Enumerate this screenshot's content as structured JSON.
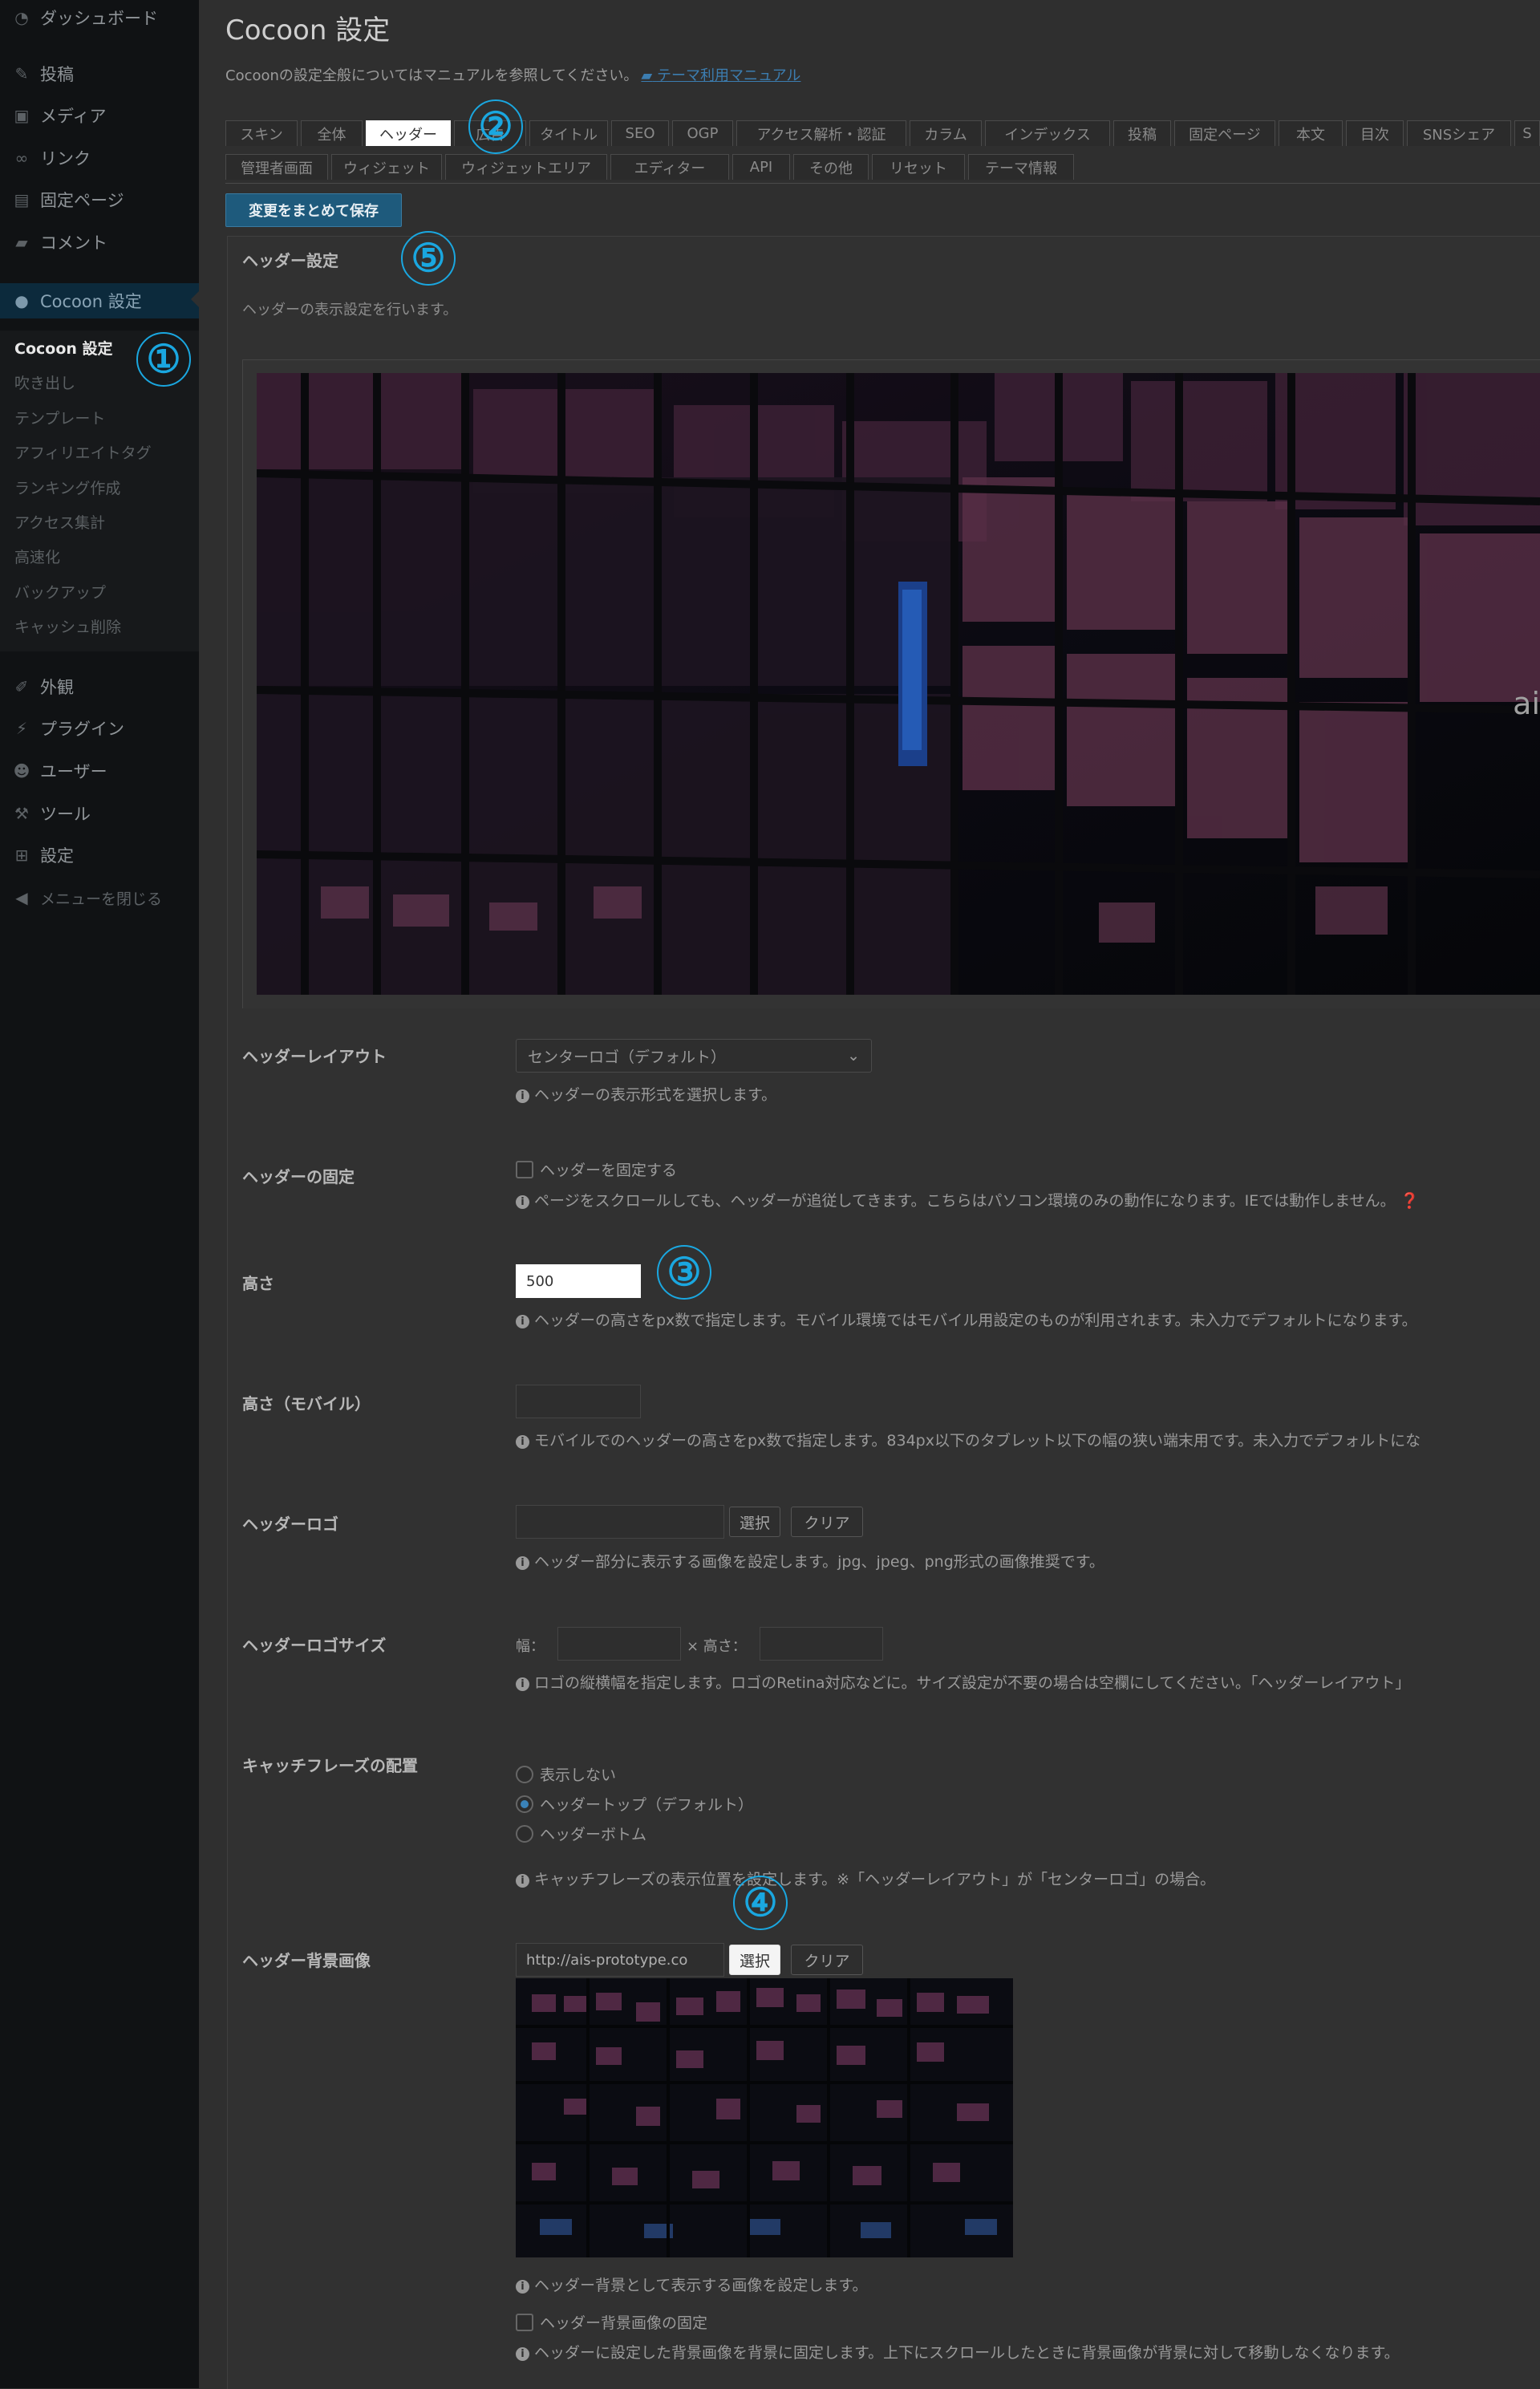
{
  "sidebar": {
    "menu": [
      {
        "label": "ダッシュボード",
        "icon": "dashboard-icon"
      },
      {
        "label": "投稿",
        "icon": "pin-icon"
      },
      {
        "label": "メディア",
        "icon": "media-icon"
      },
      {
        "label": "リンク",
        "icon": "link-icon"
      },
      {
        "label": "固定ページ",
        "icon": "page-icon"
      },
      {
        "label": "コメント",
        "icon": "comment-icon"
      },
      {
        "label": "Cocoon 設定",
        "icon": "cocoon-icon"
      }
    ],
    "submenu": [
      "Cocoon 設定",
      "吹き出し",
      "テンプレート",
      "アフィリエイトタグ",
      "ランキング作成",
      "アクセス集計",
      "高速化",
      "バックアップ",
      "キャッシュ削除"
    ],
    "menu2": [
      {
        "label": "外観",
        "icon": "brush-icon"
      },
      {
        "label": "プラグイン",
        "icon": "plugin-icon"
      },
      {
        "label": "ユーザー",
        "icon": "user-icon"
      },
      {
        "label": "ツール",
        "icon": "wrench-icon"
      },
      {
        "label": "設定",
        "icon": "settings-icon"
      },
      {
        "label": "メニューを閉じる",
        "icon": "collapse-icon"
      }
    ]
  },
  "page": {
    "title": "Cocoon 設定",
    "intro": "Cocoonの設定全般についてはマニュアルを参照してください。",
    "manual_link": "テーマ利用マニュアル"
  },
  "tabs_row1": [
    "スキン",
    "全体",
    "ヘッダー",
    "広告",
    "タイトル",
    "SEO",
    "OGP",
    "アクセス解析・認証",
    "カラム",
    "インデックス",
    "投稿",
    "固定ページ",
    "本文",
    "目次",
    "SNSシェア",
    "S"
  ],
  "tabs_row2": [
    "管理者画面",
    "ウィジェット",
    "ウィジェットエリア",
    "エディター",
    "API",
    "その他",
    "リセット",
    "テーマ情報"
  ],
  "save_button": "変更をまとめて保存",
  "panel": {
    "title": "ヘッダー設定",
    "description": "ヘッダーの表示設定を行います。",
    "preview_overlay_text": "ai"
  },
  "fields": {
    "layout": {
      "label": "ヘッダーレイアウト",
      "value": "センターロゴ（デフォルト）",
      "help": "ヘッダーの表示形式を選択します。"
    },
    "fixed": {
      "label": "ヘッダーの固定",
      "checkbox": "ヘッダーを固定する",
      "help": "ページをスクロールしても、ヘッダーが追従してきます。こちらはパソコン環境のみの動作になります。IEでは動作しません。"
    },
    "height": {
      "label": "高さ",
      "value": "500",
      "help": "ヘッダーの高さをpx数で指定します。モバイル環境ではモバイル用設定のものが利用されます。未入力でデフォルトになります。"
    },
    "height_mobile": {
      "label": "高さ（モバイル）",
      "value": "",
      "help": "モバイルでのヘッダーの高さをpx数で指定します。834px以下のタブレット以下の幅の狭い端末用です。未入力でデフォルトにな"
    },
    "logo": {
      "label": "ヘッダーロゴ",
      "value": "",
      "select": "選択",
      "clear": "クリア",
      "help": "ヘッダー部分に表示する画像を設定します。jpg、jpeg、png形式の画像推奨です。"
    },
    "logo_size": {
      "label": "ヘッダーロゴサイズ",
      "width_label": "幅：",
      "height_label": "× 高さ：",
      "help": "ロゴの縦横幅を指定します。ロゴのRetina対応などに。サイズ設定が不要の場合は空欄にしてください。「ヘッダーレイアウト」"
    },
    "catchphrase": {
      "label": "キャッチフレーズの配置",
      "options": [
        "表示しない",
        "ヘッダートップ（デフォルト）",
        "ヘッダーボトム"
      ],
      "selected": 1,
      "help": "キャッチフレーズの表示位置を設定します。※「ヘッダーレイアウト」が「センターロゴ」の場合。"
    },
    "bg_image": {
      "label": "ヘッダー背景画像",
      "value": "http://ais-prototype.co",
      "select": "選択",
      "clear": "クリア",
      "help": "ヘッダー背景として表示する画像を設定します。",
      "fix_checkbox": "ヘッダー背景画像の固定",
      "fix_help": "ヘッダーに設定した背景画像を背景に固定します。上下にスクロールしたときに背景画像が背景に対して移動しなくなります。"
    }
  },
  "markers": [
    "①",
    "②",
    "③",
    "④",
    "⑤"
  ],
  "colors": {
    "accent": "#1aa7e0",
    "save_button": "#1e5a7c",
    "link": "#3c7db0"
  }
}
